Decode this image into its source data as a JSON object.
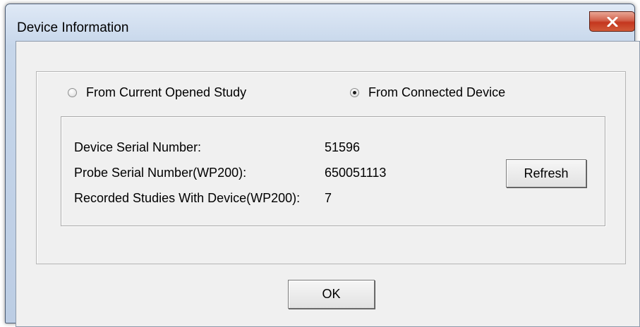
{
  "window": {
    "title": "Device Information",
    "close_glyph": "x"
  },
  "source": {
    "options": [
      {
        "label": "From Current Opened Study",
        "selected": false
      },
      {
        "label": "From Connected Device",
        "selected": true
      }
    ]
  },
  "info": {
    "rows": [
      {
        "label": "Device Serial Number:",
        "value": "51596"
      },
      {
        "label": "Probe Serial Number(WP200):",
        "value": "650051113"
      },
      {
        "label": "Recorded Studies With Device(WP200):",
        "value": "7"
      }
    ],
    "refresh_label": "Refresh"
  },
  "footer": {
    "ok_label": "OK"
  },
  "colors": {
    "titlebar": "#c6d6ea",
    "close_button": "#c4361f",
    "dialog_bg": "#f0f0f0"
  }
}
